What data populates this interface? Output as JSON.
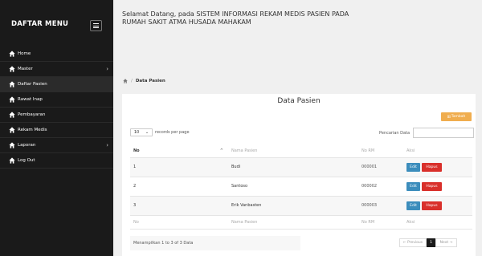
{
  "sidebar": {
    "brand": "DAFTAR MENU",
    "items": [
      {
        "label": "Home",
        "caret": ""
      },
      {
        "label": "Master",
        "caret": "›"
      },
      {
        "label": "Daftar Pasien",
        "caret": ""
      },
      {
        "label": "Rawat Inap",
        "caret": ""
      },
      {
        "label": "Pembayaran",
        "caret": ""
      },
      {
        "label": "Rekam Medis",
        "caret": ""
      },
      {
        "label": "Laporan",
        "caret": "›"
      },
      {
        "label": "Log Out",
        "caret": ""
      }
    ]
  },
  "header": {
    "welcome": "Selamat Datang, pada SISTEM INFORMASI REKAM MEDIS PASIEN PADA RUMAH SAKIT ATMA HUSADA MAHAKAM"
  },
  "breadcrumb": {
    "home_icon": "home-icon",
    "current": "Data Pasien"
  },
  "panel": {
    "title": "Data Pasien",
    "add_label": "Tambah",
    "length_value": "10",
    "length_suffix": "records per page",
    "search_label": "Pencarian Data",
    "search_value": ""
  },
  "table": {
    "headers": {
      "no": "No",
      "nama": "Nama Pasien",
      "rm": "No RM",
      "aksi": "Aksi"
    },
    "sort_indicator": "^",
    "rows": [
      {
        "no": "1",
        "nama": "Budi",
        "rm": "000001",
        "edit": "Edit",
        "hapus": "Hapus"
      },
      {
        "no": "2",
        "nama": "Santoso",
        "rm": "000002",
        "edit": "Edit",
        "hapus": "Hapus"
      },
      {
        "no": "3",
        "nama": "Erik Vanbasten",
        "rm": "000003",
        "edit": "Edit",
        "hapus": "Hapus"
      }
    ]
  },
  "footer": {
    "info": "Menampilkan 1 to 3 of 3 Data",
    "prev": "← Previous",
    "current_page": "1",
    "next": "Next →"
  },
  "colors": {
    "sidebar_bg": "#1a1a1a",
    "edit": "#3c8dbc",
    "hapus": "#d9302b",
    "tambah": "#f0ad4e"
  }
}
